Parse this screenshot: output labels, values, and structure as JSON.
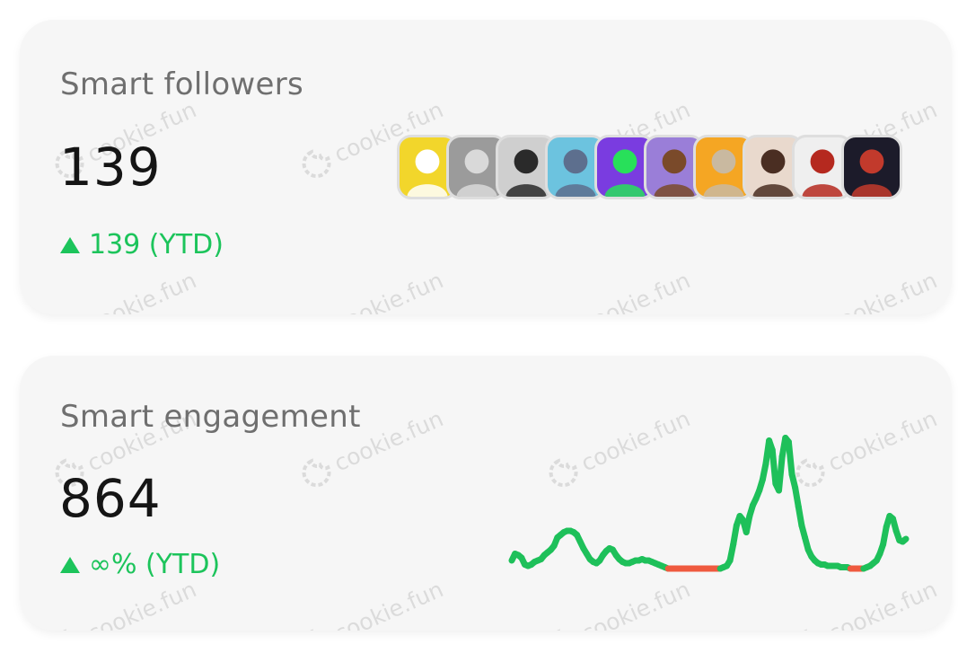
{
  "watermark": "cookie.fun",
  "followers": {
    "title": "Smart followers",
    "value": "139",
    "delta": "139 (YTD)",
    "avatars": [
      {
        "name": "penguin-avatar",
        "bg": "#f2d62b",
        "fg": "#ffffff"
      },
      {
        "name": "statue-avatar",
        "bg": "#9b9b9b",
        "fg": "#d9d9d9"
      },
      {
        "name": "man-avatar",
        "bg": "#cfcfcf",
        "fg": "#2a2a2a"
      },
      {
        "name": "ape-avatar",
        "bg": "#6cc3df",
        "fg": "#5d6f8e"
      },
      {
        "name": "alien-avatar",
        "bg": "#7a3ce0",
        "fg": "#28e05a"
      },
      {
        "name": "punk-avatar",
        "bg": "#9a7ed8",
        "fg": "#7a4a2a"
      },
      {
        "name": "ape-gold-avatar",
        "bg": "#f5a623",
        "fg": "#c9b9a0"
      },
      {
        "name": "woman-avatar",
        "bg": "#e9d9cd",
        "fg": "#4a2e22"
      },
      {
        "name": "anime-avatar",
        "bg": "#efefef",
        "fg": "#b5291f"
      },
      {
        "name": "abstract-avatar",
        "bg": "#1c1b2a",
        "fg": "#c23a2c"
      }
    ]
  },
  "engagement": {
    "title": "Smart engagement",
    "value": "864",
    "delta": "∞% (YTD)",
    "line_color": "#1ec05a",
    "zero_color": "#ef5a3f",
    "series": [
      0.08,
      0.13,
      0.12,
      0.1,
      0.05,
      0.04,
      0.05,
      0.07,
      0.08,
      0.09,
      0.12,
      0.14,
      0.16,
      0.19,
      0.25,
      0.27,
      0.29,
      0.3,
      0.3,
      0.29,
      0.27,
      0.22,
      0.17,
      0.13,
      0.09,
      0.07,
      0.06,
      0.08,
      0.12,
      0.15,
      0.17,
      0.16,
      0.12,
      0.09,
      0.07,
      0.06,
      0.06,
      0.07,
      0.08,
      0.08,
      0.09,
      0.08,
      0.08,
      0.07,
      0.06,
      0.05,
      0.04,
      0.03,
      0.02,
      0.02,
      0.02,
      0.02,
      0.02,
      0.02,
      0.02,
      0.02,
      0.02,
      0.02,
      0.02,
      0.02,
      0.02,
      0.02,
      0.02,
      0.02,
      0.02,
      0.03,
      0.04,
      0.08,
      0.2,
      0.34,
      0.41,
      0.38,
      0.29,
      0.41,
      0.49,
      0.54,
      0.6,
      0.68,
      0.8,
      0.97,
      0.9,
      0.65,
      0.6,
      0.85,
      0.99,
      0.96,
      0.72,
      0.62,
      0.48,
      0.34,
      0.25,
      0.16,
      0.11,
      0.08,
      0.06,
      0.05,
      0.05,
      0.04,
      0.04,
      0.04,
      0.04,
      0.03,
      0.03,
      0.03,
      0.02,
      0.02,
      0.02,
      0.02,
      0.02,
      0.03,
      0.04,
      0.06,
      0.08,
      0.13,
      0.2,
      0.33,
      0.41,
      0.39,
      0.3,
      0.23,
      0.22,
      0.24
    ]
  }
}
